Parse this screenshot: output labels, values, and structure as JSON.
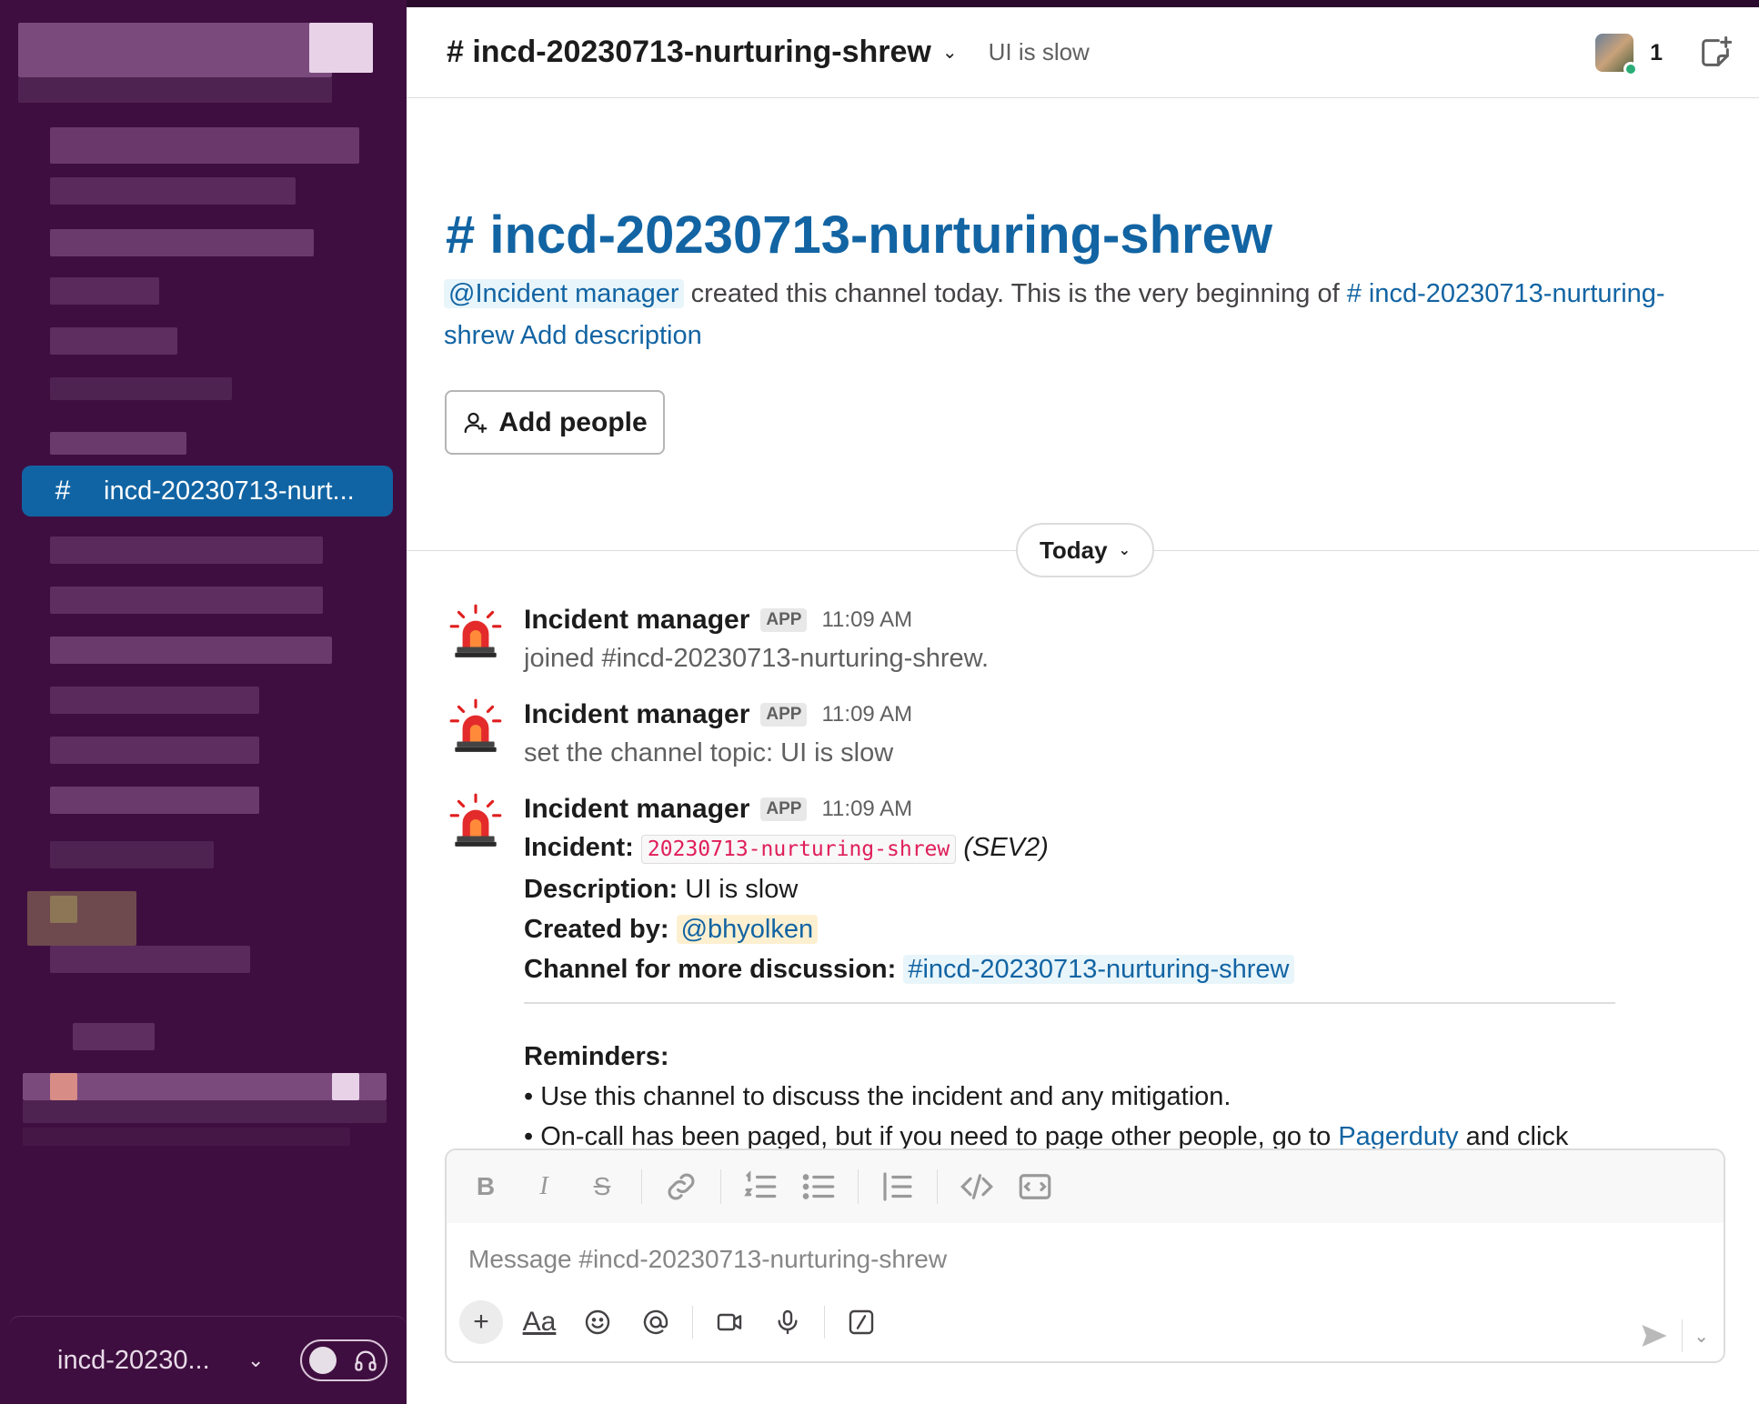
{
  "header": {
    "channel_title": "# incd-20230713-nurturing-shrew",
    "topic": "UI is slow",
    "member_count": "1"
  },
  "sidebar": {
    "selected_channel_hash": "#",
    "selected_channel_label": "incd-20230713-nurt...",
    "footer_label": "incd-20230...",
    "colors": {
      "background": "#3f0e40",
      "selected": "#1164a3"
    }
  },
  "intro": {
    "title": "# incd-20230713-nurturing-shrew",
    "creator_mention": "@Incident manager",
    "text_middle": " created this channel today. This is the very beginning of ",
    "channel_link": "# incd-20230713-nurturing-shrew",
    "add_description": "Add description",
    "add_people_label": "Add people"
  },
  "divider": {
    "label": "Today"
  },
  "messages": [
    {
      "sender": "Incident manager",
      "badge": "APP",
      "time": "11:09 AM",
      "text": "joined #incd-20230713-nurturing-shrew."
    },
    {
      "sender": "Incident manager",
      "badge": "APP",
      "time": "11:09 AM",
      "text": "set the channel topic: UI is slow"
    },
    {
      "sender": "Incident manager",
      "badge": "APP",
      "time": "11:09 AM",
      "incident_label": "Incident:",
      "incident_code": "20230713-nurturing-shrew",
      "incident_sev": "(SEV2)",
      "description_label": "Description:",
      "description_value": "UI is slow",
      "created_by_label": "Created by:",
      "created_by_value": "@bhyolken",
      "channel_label": "Channel for more discussion:",
      "channel_value": "#incd-20230713-nurturing-shrew",
      "reminders_label": "Reminders:",
      "reminder_1": "• Use this channel to discuss the incident and any mitigation.",
      "reminder_2_pre": "• On-call has been paged, but if you need to page other people, go to ",
      "reminder_2_link": "Pagerduty",
      "reminder_2_post": " and click"
    }
  ],
  "composer": {
    "placeholder": "Message #incd-20230713-nurturing-shrew",
    "format_label": "Aa",
    "toolbar_icons": [
      "bold-icon",
      "italic-icon",
      "strikethrough-icon",
      "link-icon",
      "ordered-list-icon",
      "bulleted-list-icon",
      "blockquote-icon",
      "code-icon",
      "code-block-icon"
    ]
  },
  "colors": {
    "link": "#1264a3",
    "code_text": "#e01e5a",
    "user_mention_bg": "#fdf0d1",
    "channel_mention_bg": "#e8f5fa"
  }
}
